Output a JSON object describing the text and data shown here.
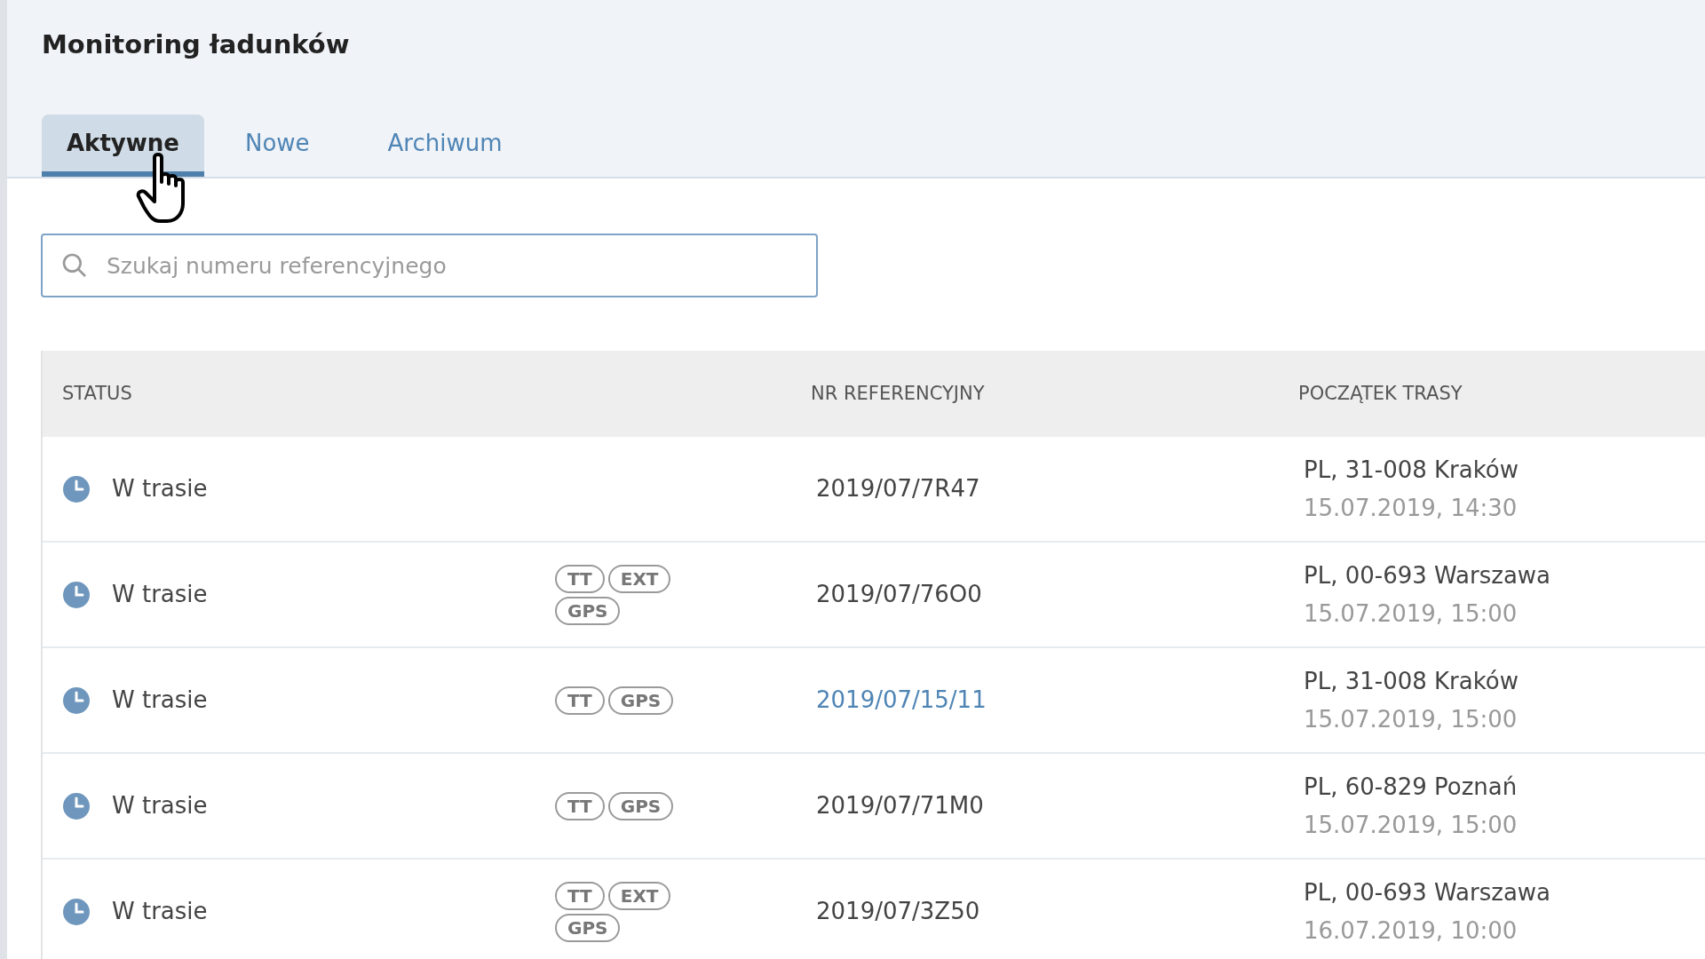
{
  "page": {
    "title": "Monitoring ładunków"
  },
  "tabs": [
    {
      "label": "Aktywne",
      "selected": true
    },
    {
      "label": "Nowe",
      "selected": false
    },
    {
      "label": "Archiwum",
      "selected": false
    }
  ],
  "search": {
    "placeholder": "Szukaj numeru referencyjnego"
  },
  "table": {
    "columns": [
      "STATUS",
      "NR REFERENCYJNY",
      "POCZĄTEK TRASY"
    ],
    "rows": [
      {
        "status": "W trasie",
        "tags": [],
        "reference": "2019/07/7R47",
        "highlighted": false,
        "route": "PL, 31-008 Kraków",
        "date": "15.07.2019, 14:30"
      },
      {
        "status": "W trasie",
        "tags": [
          "TT",
          "EXT",
          "GPS"
        ],
        "reference": "2019/07/76O0",
        "highlighted": false,
        "route": "PL, 00-693 Warszawa",
        "date": "15.07.2019, 15:00"
      },
      {
        "status": "W trasie",
        "tags": [
          "TT",
          "GPS"
        ],
        "reference": "2019/07/15/11",
        "highlighted": true,
        "route": "PL, 31-008 Kraków",
        "date": "15.07.2019, 15:00"
      },
      {
        "status": "W trasie",
        "tags": [
          "TT",
          "GPS"
        ],
        "reference": "2019/07/71M0",
        "highlighted": false,
        "route": "PL, 60-829 Poznań",
        "date": "15.07.2019, 15:00"
      },
      {
        "status": "W trasie",
        "tags": [
          "TT",
          "EXT",
          "GPS"
        ],
        "reference": "2019/07/3Z50",
        "highlighted": false,
        "route": "PL, 00-693 Warszawa",
        "date": "16.07.2019, 10:00"
      }
    ]
  }
}
